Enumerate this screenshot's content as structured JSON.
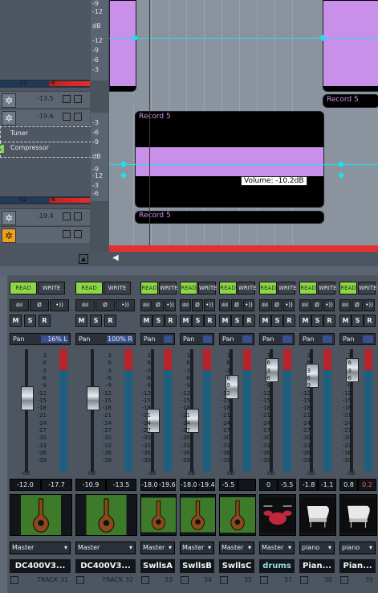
{
  "trackview": {
    "scale_top": [
      "-9",
      "-12",
      "dB",
      "-12",
      "-9",
      "-6",
      "-3"
    ],
    "scale_mid": [
      "-3",
      "-6",
      "-9",
      "dB",
      "-9",
      "-12",
      "-3",
      "-6"
    ],
    "tracks": [
      {
        "vol": "-13.5",
        "meter_left": "-12",
        "meter_right": "-6"
      },
      {
        "vol": "-19.6",
        "fx": [
          "Tuner",
          "Compressor"
        ],
        "meter_left": "-12",
        "meter_right": "-6"
      },
      {
        "vol": "-19.4"
      }
    ],
    "clip_labels": [
      "Record 5",
      "Record 5",
      "Record 5",
      "Record 5"
    ],
    "tooltip": "Volume: -10.2dB",
    "envelope_color": "#1ee0ea",
    "wave_color": "#c890e8"
  },
  "console": {
    "read_label": "READ",
    "write_label": "WRITE",
    "msr": [
      "M",
      "S",
      "R"
    ],
    "meter_scale": [
      "3",
      "6",
      "-3",
      "-6",
      "-9",
      "-12",
      "-15",
      "-18",
      "-21",
      "-24",
      "-27",
      "-30",
      "-33",
      "-36",
      "-39"
    ],
    "db_label": "dB",
    "strips": [
      {
        "pan": "Pan",
        "pan_val": "16% L",
        "fader": "-12.0",
        "peak": "-17.7",
        "out": "Master",
        "name": "DC400V3...",
        "num": "TRACK 31",
        "thumb": "guitar-icon",
        "fader_level": 0.6
      },
      {
        "pan": "Pan",
        "pan_val": "100% R",
        "fader": "-10.9",
        "peak": "-13.5",
        "out": "Master",
        "name": "DC400V3...",
        "num": "TRACK 32",
        "thumb": "guitar-icon",
        "fader_level": 0.6
      },
      {
        "pan": "Pan",
        "pan_val": "",
        "fader": "-18.0",
        "peak": "-19.6",
        "out": "Master",
        "name": "SwllsA",
        "num": "33",
        "thumb": "guitar-icon",
        "fader_level": 0.4
      },
      {
        "pan": "Pan",
        "pan_val": "",
        "fader": "-18.0",
        "peak": "-19.4",
        "out": "Master",
        "name": "SwllsB",
        "num": "34",
        "thumb": "guitar-icon",
        "fader_level": 0.4
      },
      {
        "pan": "Pan",
        "pan_val": "",
        "fader": "-5.5",
        "peak": "",
        "out": "Master",
        "name": "SwllsC",
        "num": "35",
        "thumb": "guitar-icon",
        "fader_level": 0.7
      },
      {
        "pan": "Pan",
        "pan_val": "",
        "fader": "0",
        "peak": "-5.5",
        "out": "Master",
        "name": "drums",
        "num": "37",
        "thumb": "drums-icon",
        "fader_level": 0.85
      },
      {
        "pan": "Pan",
        "pan_val": "",
        "fader": "-1.8",
        "peak": "-1.1",
        "out": "piano",
        "name": "Pian...",
        "num": "38",
        "thumb": "piano-icon",
        "fader_level": 0.8
      },
      {
        "pan": "Pan",
        "pan_val": "",
        "fader": "0.8",
        "peak": "0.2",
        "out": "piano",
        "name": "Pian...",
        "num": "39",
        "thumb": "piano-icon",
        "fader_level": 0.85
      }
    ]
  }
}
